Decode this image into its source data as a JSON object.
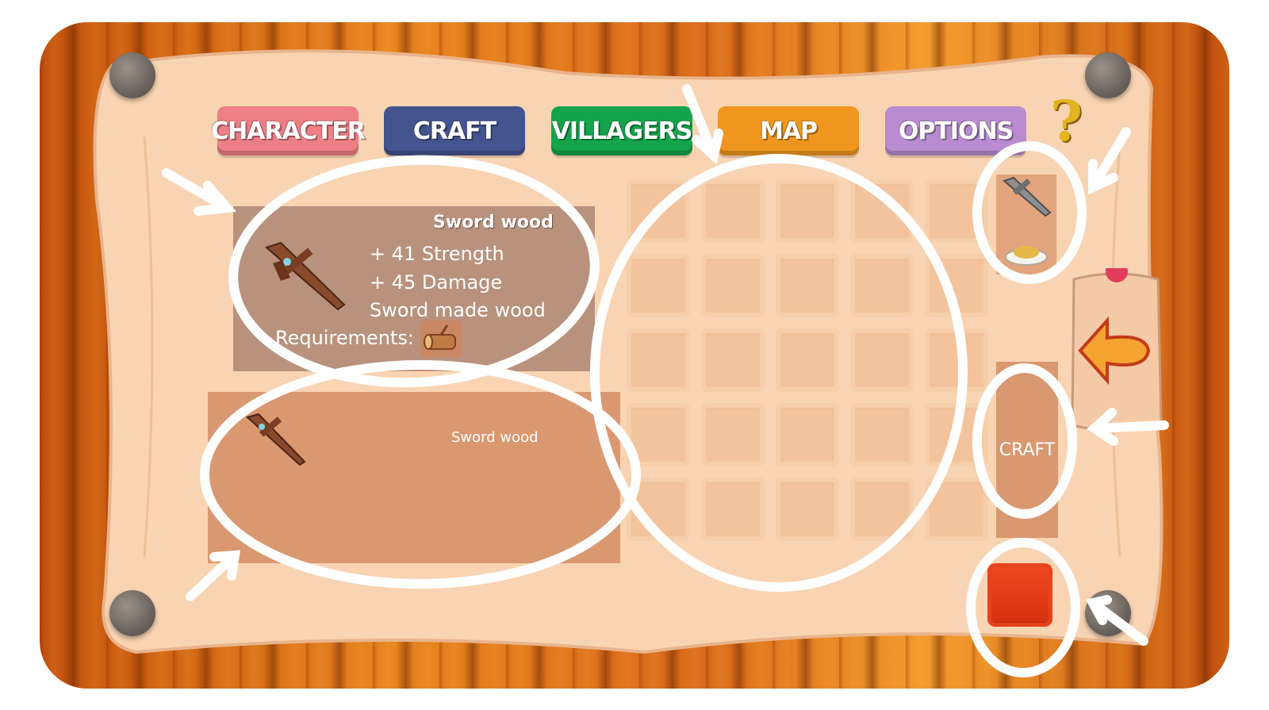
{
  "tabs": [
    {
      "label": "CHARACTER",
      "color": "#ee7f86"
    },
    {
      "label": "CRAFT",
      "color": "#44548f"
    },
    {
      "label": "VILLAGERS",
      "color": "#14a44c"
    },
    {
      "label": "MAP",
      "color": "#f0961e"
    },
    {
      "label": "OPTIONS",
      "color": "#b98bd0"
    }
  ],
  "help_label": "?",
  "detail": {
    "title": "Sword wood",
    "lines": [
      "+ 41 Strength",
      "+ 45 Damage",
      "Sword made wood"
    ],
    "requirements_label": "Requirements:",
    "requirement_item_icon": "wood-log-icon",
    "item_icon": "wooden-sword-icon"
  },
  "recipe_list": {
    "items": [
      {
        "label": "Sword wood",
        "icon": "wooden-sword-icon"
      }
    ]
  },
  "inventory_grid": {
    "rows": 5,
    "cols": 5
  },
  "side_slots": [
    {
      "icon": "stone-sword-icon"
    },
    {
      "icon": "food-plate-icon"
    }
  ],
  "craft_button": {
    "label": "CRAFT"
  },
  "back_button": {
    "icon": "back-arrow-icon"
  },
  "stop_button": {
    "icon": "red-square-icon"
  },
  "colors": {
    "parchment": "#f9d4b2",
    "wood_frame": "#e07a1a",
    "annotation": "#ffffff"
  }
}
